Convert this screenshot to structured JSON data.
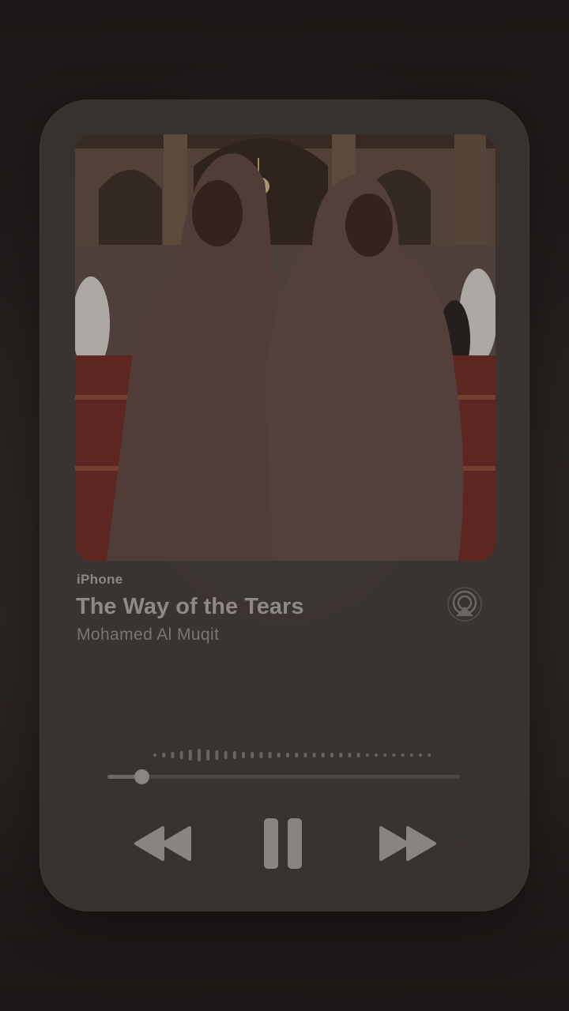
{
  "player": {
    "device": "iPhone",
    "title": "The Way of the Tears",
    "artist": "Mohamed Al Muqit",
    "progress": 0.06
  },
  "controls": {
    "rewind_icon": "backward-icon",
    "pause_icon": "pause-icon",
    "forward_icon": "forward-icon",
    "airplay_icon": "airplay-icon"
  },
  "colors": {
    "card": "#3e3835",
    "text_primary": "#8f8884",
    "text_secondary": "#7b7572",
    "control": "#8a8480"
  }
}
